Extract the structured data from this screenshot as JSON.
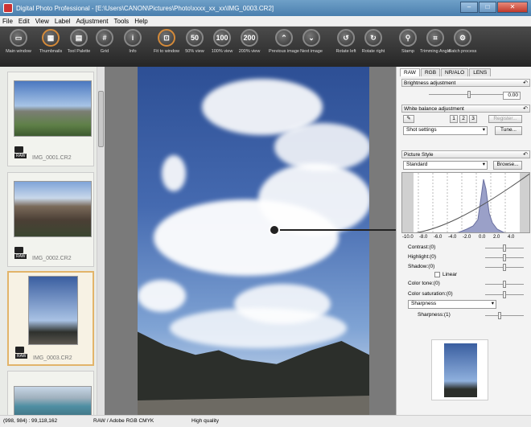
{
  "window": {
    "title": "Digital Photo Professional - [E:\\Users\\CANON\\Pictures\\Photo\\xxxx_xx_xx\\IMG_0003.CR2]"
  },
  "menu": [
    "File",
    "Edit",
    "View",
    "Label",
    "Adjustment",
    "Tools",
    "Help"
  ],
  "toolbar": [
    {
      "label": "Main window",
      "icon": "folder-icon"
    },
    {
      "label": "Thumbnails",
      "icon": "thumbnails-icon"
    },
    {
      "label": "Tool Palette",
      "icon": "tool-palette-icon"
    },
    {
      "label": "Grid",
      "icon": "grid-icon"
    },
    {
      "label": "Info",
      "icon": "info-icon"
    },
    {
      "label": "Fit to window",
      "icon": "fit-window-icon"
    },
    {
      "label": "50% view",
      "icon": "50"
    },
    {
      "label": "100% view",
      "icon": "100"
    },
    {
      "label": "200% view",
      "icon": "200"
    },
    {
      "label": "Previous image",
      "icon": "chevron-up-icon"
    },
    {
      "label": "Next image",
      "icon": "chevron-down-icon"
    },
    {
      "label": "Rotate left",
      "icon": "rotate-left-icon"
    },
    {
      "label": "Rotate right",
      "icon": "rotate-right-icon"
    },
    {
      "label": "Stamp",
      "icon": "stamp-icon"
    },
    {
      "label": "Trimming Angle",
      "icon": "trimming-icon"
    },
    {
      "label": "Batch process",
      "icon": "batch-icon"
    }
  ],
  "thumbnails": [
    {
      "name": "IMG_0001.CR2",
      "badge": "RAW"
    },
    {
      "name": "IMG_0002.CR2",
      "badge": "RAW"
    },
    {
      "name": "IMG_0003.CR2",
      "badge": "RAW"
    }
  ],
  "panel": {
    "tabs": [
      "RAW",
      "RGB",
      "NR/ALO",
      "LENS"
    ],
    "brightness": {
      "title": "Brightness adjustment",
      "value": "0.00"
    },
    "wb": {
      "title": "White balance adjustment",
      "b1": "1",
      "b2": "2",
      "b3": "3",
      "register": "Register...",
      "select": "Shot settings",
      "tune": "Tune..."
    },
    "style": {
      "title": "Picture Style",
      "select": "Standard",
      "browse": "Browse..."
    },
    "hist_labels": [
      "-10.0",
      "-8.0",
      "-6.0",
      "-4.0",
      "-2.0",
      "0.0",
      "2.0",
      "4.0"
    ],
    "contrast": "Contrast:(0)",
    "highlight": "Highlight:(0)",
    "shadow": "Shadow:(0)",
    "linear": "Linear",
    "color_tone": "Color tone:(0)",
    "color_sat": "Color saturation:(0)",
    "sharp_select": "Sharpness",
    "sharpness": "Sharpness:(1)"
  },
  "status": {
    "coords": "(998, 984) : 99,118,162",
    "profile": "RAW / Adobe RGB  CMYK",
    "quality": "High quality"
  }
}
